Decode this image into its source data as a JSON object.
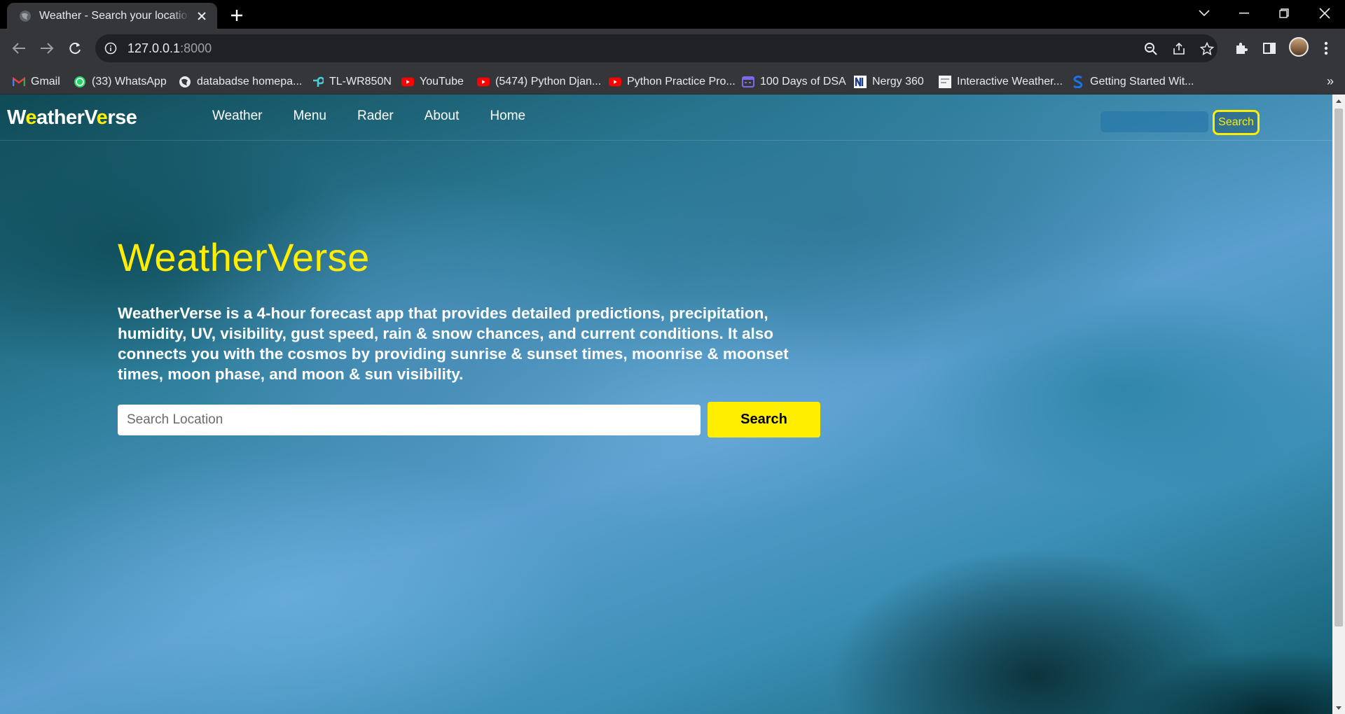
{
  "browser": {
    "tab": {
      "title": "Weather - Search your location to get the weather",
      "favicon": "globe-icon"
    },
    "address": {
      "host": "127.0.0.1",
      "port": ":8000"
    },
    "bookmarks": [
      {
        "label": "Gmail",
        "icon": "gmail-icon",
        "color": "#ea4335"
      },
      {
        "label": "(33) WhatsApp",
        "icon": "whatsapp-icon",
        "color": "#25d366"
      },
      {
        "label": "databadse homepa...",
        "icon": "globe-icon",
        "color": "#e8eaed"
      },
      {
        "label": "TL-WR850N",
        "icon": "tplink-icon",
        "color": "#4acbd6"
      },
      {
        "label": "YouTube",
        "icon": "youtube-icon",
        "color": "#ff0000"
      },
      {
        "label": "(5474) Python Djan...",
        "icon": "youtube-icon",
        "color": "#ff0000"
      },
      {
        "label": "Python Practice Pro...",
        "icon": "youtube-icon",
        "color": "#ff0000"
      },
      {
        "label": "100 Days of DSA",
        "icon": "calendar-icon",
        "color": "#7b68ee"
      },
      {
        "label": "Nergy 360",
        "icon": "nergy-icon",
        "color": "#ffffff"
      },
      {
        "label": "Interactive Weather...",
        "icon": "page-icon",
        "color": "#ffffff"
      },
      {
        "label": "Getting Started Wit...",
        "icon": "s-logo-icon",
        "color": "#1a73e8"
      }
    ]
  },
  "site": {
    "brand": {
      "part1": "W",
      "part2": "e",
      "part3": "atherV",
      "part4": "e",
      "part5": "rse"
    },
    "nav": [
      "Weather",
      "Menu",
      "Rader",
      "About",
      "Home"
    ],
    "nav_search_button": "Search",
    "hero": {
      "title": "WeatherVerse",
      "description": "WeatherVerse is a 4-hour forecast app that provides detailed predictions, precipitation, humidity, UV, visibility, gust speed, rain & snow chances, and current conditions. It also connects you with the cosmos by providing sunrise & sunset times, moonrise & moonset times, moon phase, and moon & sun visibility.",
      "search_placeholder": "Search Location",
      "search_button": "Search"
    },
    "colors": {
      "accent": "#ffee00",
      "text": "#ffffff"
    }
  }
}
